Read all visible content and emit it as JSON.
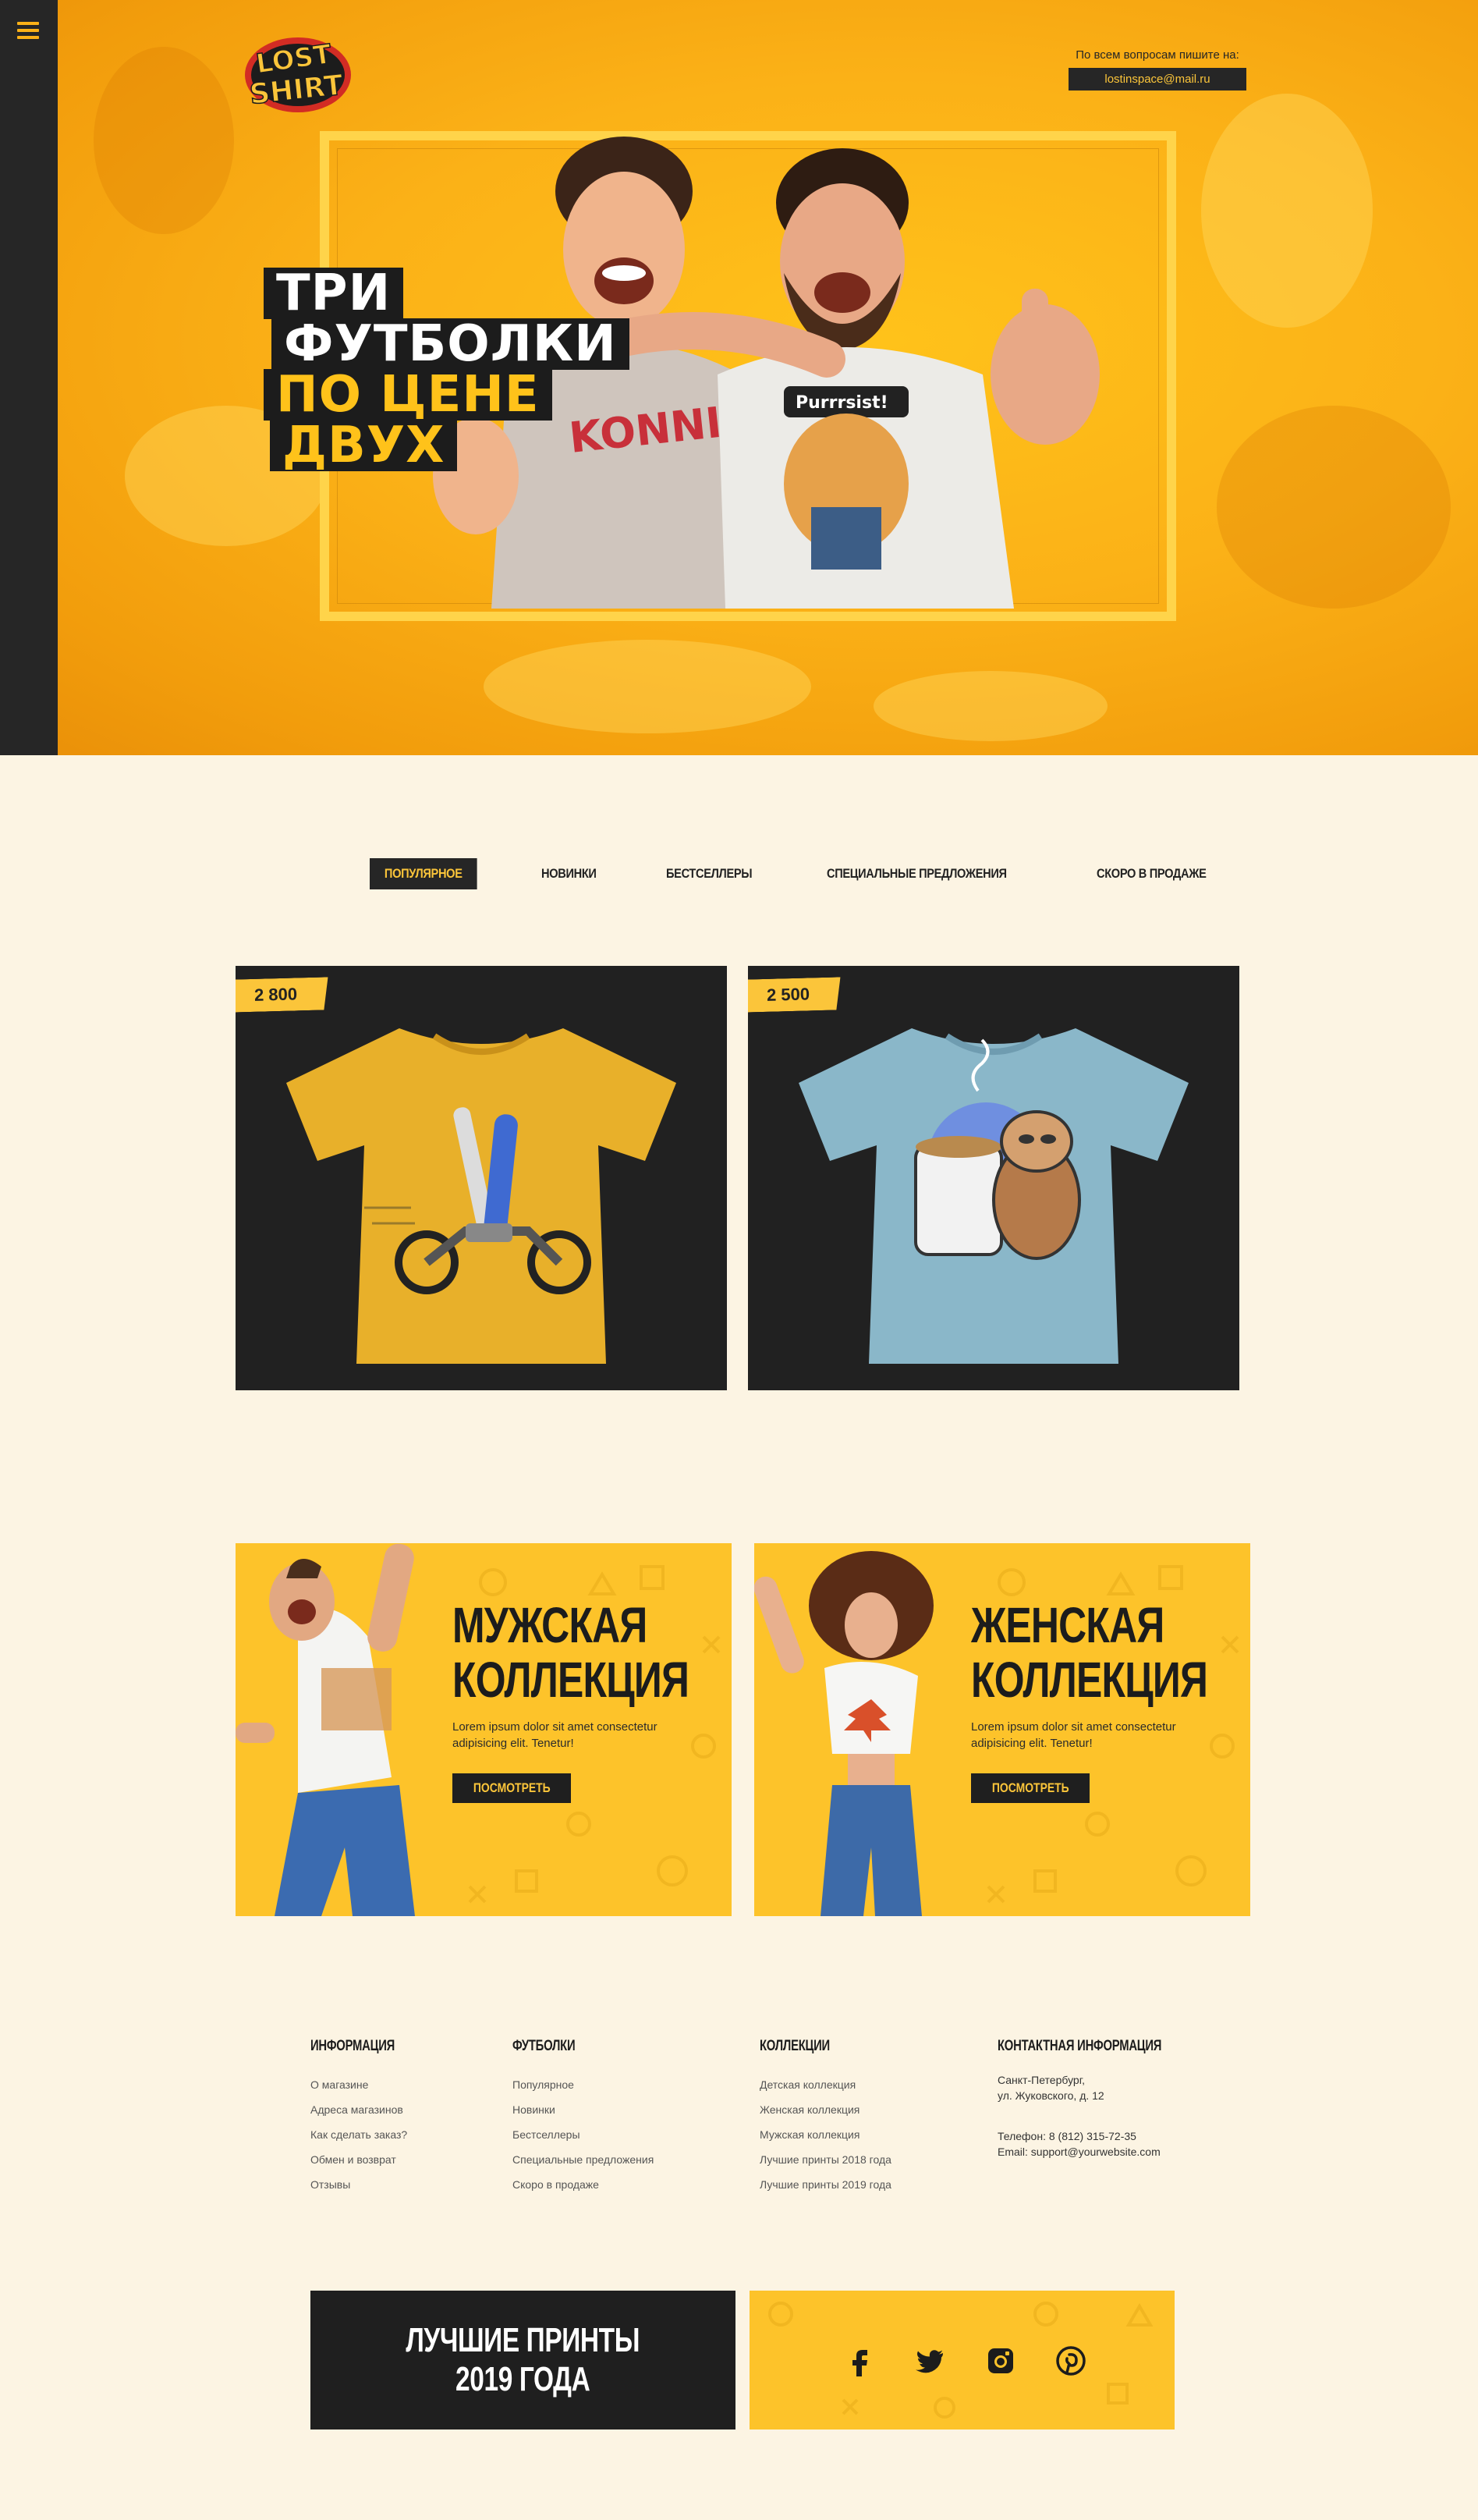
{
  "brand": {
    "logo_top": "LOST",
    "logo_bottom": "SHIRT"
  },
  "header": {
    "contact_label": "По всем вопросам пишите на:",
    "contact_email": "lostinspace@mail.ru"
  },
  "hero": {
    "line1": "ТРИ",
    "line2": "ФУТБОЛКИ",
    "line3": "ПО ЦЕНЕ",
    "line4": "ДВУХ",
    "shirt_print_left": "KONNICHIWA",
    "shirt_print_right": "Purrrsist!"
  },
  "tabs": [
    {
      "label": "ПОПУЛЯРНОЕ",
      "active": true
    },
    {
      "label": "НОВИНКИ",
      "active": false
    },
    {
      "label": "БЕСТСЕЛЛЕРЫ",
      "active": false
    },
    {
      "label": "СПЕЦИАЛЬНЫЕ ПРЕДЛОЖЕНИЯ",
      "active": false
    },
    {
      "label": "СКОРО В ПРОДАЖЕ",
      "active": false
    }
  ],
  "products": [
    {
      "price": "2 800",
      "shirt_color": "#e8b02a"
    },
    {
      "price": "2 500",
      "shirt_color": "#8ab7c9"
    }
  ],
  "collections": [
    {
      "title_1": "МУЖСКАЯ",
      "title_2": "КОЛЛЕКЦИЯ",
      "text": "Lorem ipsum dolor sit amet consectetur adipisicing elit. Tenetur!",
      "button": "ПОСМОТРЕТЬ"
    },
    {
      "title_1": "ЖЕНСКАЯ",
      "title_2": "КОЛЛЕКЦИЯ",
      "text": "Lorem ipsum dolor sit amet consectetur adipisicing elit. Tenetur!",
      "button": "ПОСМОТРЕТЬ"
    }
  ],
  "footer": {
    "info": {
      "title": "ИНФОРМАЦИЯ",
      "links": [
        "О магазине",
        "Адреса магазинов",
        "Как сделать заказ?",
        "Обмен и возврат",
        "Отзывы"
      ]
    },
    "tshirts": {
      "title": "ФУТБОЛКИ",
      "links": [
        "Популярное",
        "Новинки",
        "Бестселлеры",
        "Специальные предложения",
        "Скоро в продаже"
      ]
    },
    "collections": {
      "title": "КОЛЛЕКЦИИ",
      "links": [
        "Детская коллекция",
        "Женская коллекция",
        "Мужская коллекция",
        "Лучшие принты 2018 года",
        "Лучшие принты 2019 года"
      ]
    },
    "contacts": {
      "title": "КОНТАКТНАЯ ИНФОРМАЦИЯ",
      "city": "Санкт-Петербург,",
      "street": "ул. Жуковского, д. 12",
      "phone": "Телефон: 8 (812) 315-72-35",
      "email": "Email: support@yourwebsite.com"
    }
  },
  "best_prints": {
    "line1": "ЛУЧШИЕ ПРИНТЫ",
    "line2": "2019 ГОДА"
  },
  "social": [
    "facebook-icon",
    "twitter-icon",
    "instagram-icon",
    "pinterest-icon"
  ],
  "colors": {
    "accent": "#fbc53a",
    "dark": "#262626",
    "hero_orange": "#fbb117",
    "page_bg": "#fcf4e3"
  }
}
